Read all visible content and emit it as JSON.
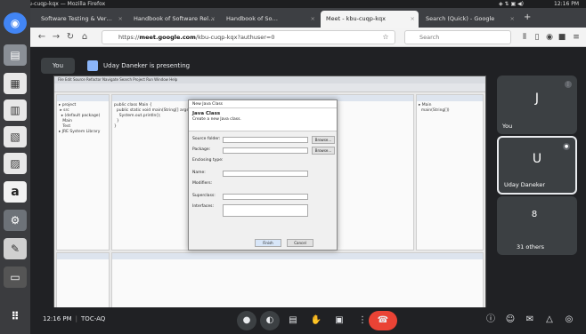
{
  "system": {
    "window_title": "Meet - kbu-cuqp-kqx — Mozilla Firefox",
    "clock": "12:16 PM"
  },
  "tabs": [
    {
      "label": "Software Testing & Ver…",
      "active": false
    },
    {
      "label": "Handbook of Software Rel…",
      "active": false
    },
    {
      "label": "Handbook of So…",
      "active": false
    },
    {
      "label": "Meet - kbu-cuqp-kqx",
      "active": true
    },
    {
      "label": "Search (Quick) - Google",
      "active": false
    }
  ],
  "navbar": {
    "url_prefix": "https://",
    "url_domain": "meet.google.com",
    "url_path": "/kbu-cuqp-kqx?authuser=0",
    "search_placeholder": "Search"
  },
  "meet": {
    "you_label": "You",
    "presenting_text": "Uday Daneker is presenting",
    "meeting_time": "12:16 PM",
    "meeting_code": "TOC-AQ"
  },
  "dialog": {
    "title": "New Java Class",
    "header_title": "Java Class",
    "header_desc": "Create a new Java class.",
    "rows": [
      "Source folder:",
      "Package:",
      "Enclosing type:",
      "Name:",
      "Modifiers:",
      "Superclass:",
      "Interfaces:"
    ],
    "buttons": {
      "browse": "Browse...",
      "finish": "Finish",
      "cancel": "Cancel"
    }
  },
  "participants": [
    {
      "initial": "J",
      "name": "You",
      "color": "#5f6368"
    },
    {
      "initial": "U",
      "name": "Uday Daneker",
      "color": "#7f8b8f"
    },
    {
      "initial": "8",
      "name": "31 others",
      "color": "#5f6368"
    }
  ],
  "icons": {
    "dock": [
      "chrome-icon",
      "files-icon",
      "docs-icon",
      "sheets-icon",
      "slides-icon",
      "calc-icon",
      "amazon-icon",
      "settings-icon",
      "text-editor-icon",
      "terminal-icon",
      "show-apps-icon"
    ],
    "controls": [
      "mic-icon",
      "camera-icon",
      "captions-icon",
      "raise-hand-icon",
      "present-icon",
      "more-icon",
      "end-call-icon"
    ],
    "side": [
      "info-icon",
      "people-icon",
      "chat-icon",
      "activities-icon",
      "shield-icon"
    ]
  },
  "colors": {
    "end_call": "#ea4335",
    "meet_bg": "#202124",
    "tile_bg": "#3c4043"
  }
}
